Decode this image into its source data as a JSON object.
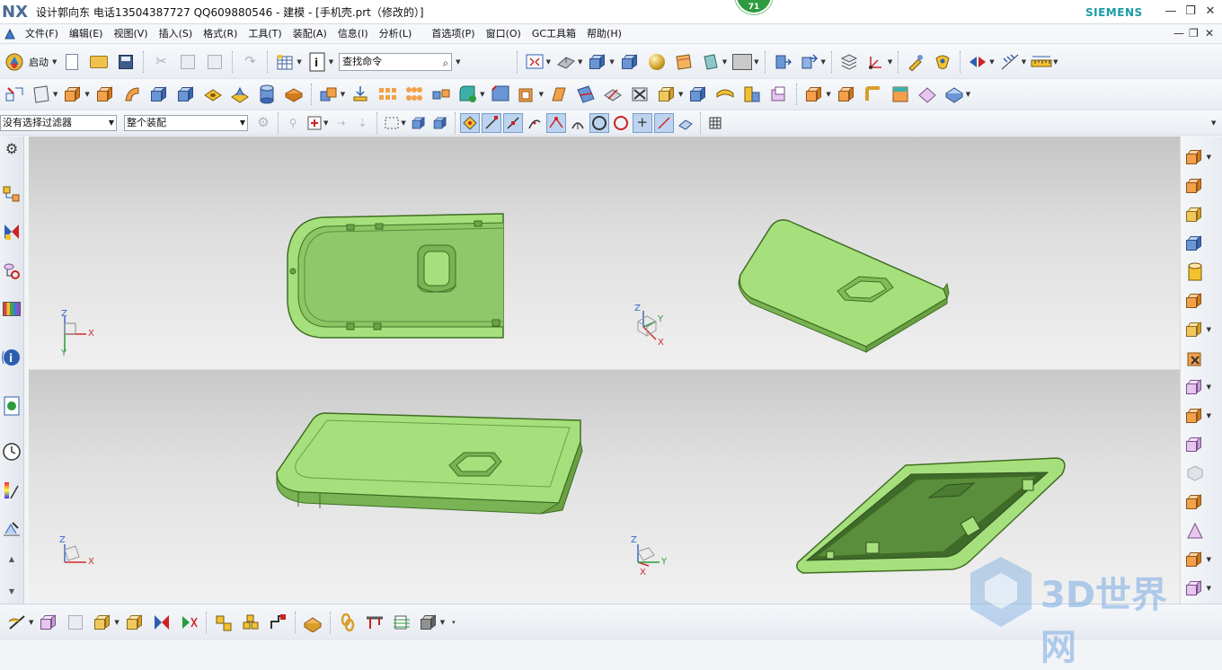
{
  "app": {
    "logo": "NX",
    "title": "设计郭向东  电话13504387727  QQ609880546 - 建模 - [手机壳.prt（修改的）]",
    "brand": "SIEMENS",
    "badge": "71",
    "window_controls": [
      "minimize-icon",
      "restore-icon",
      "close-icon"
    ]
  },
  "menu": {
    "items": [
      {
        "label": "文件(F)"
      },
      {
        "label": "编辑(E)"
      },
      {
        "label": "视图(V)"
      },
      {
        "label": "插入(S)"
      },
      {
        "label": "格式(R)"
      },
      {
        "label": "工具(T)"
      },
      {
        "label": "装配(A)"
      },
      {
        "label": "信息(I)"
      },
      {
        "label": "分析(L)"
      },
      {
        "label": "首选项(P)"
      },
      {
        "label": "窗口(O)"
      },
      {
        "label": "GC工具箱"
      },
      {
        "label": "帮助(H)"
      }
    ]
  },
  "toolbar1": {
    "start_label": "启动",
    "search_placeholder": "查找命令"
  },
  "toolbar3": {
    "selection_filter": "没有选择过滤器",
    "selection_scope": "整个装配"
  },
  "views": {
    "top_left_triad": {
      "z": "Z",
      "x": "X",
      "y": "Y"
    },
    "top_right_triad": {
      "z": "Z",
      "y": "Y",
      "x": "X"
    },
    "bottom_left_triad": {
      "z": "Z",
      "x": "X"
    },
    "bottom_right_triad": {
      "z": "Z",
      "x": "X",
      "y": "Y"
    }
  },
  "watermark": {
    "text": "3D世界网"
  },
  "colors": {
    "part_green": "#a6e07c",
    "part_edge": "#3f6e22",
    "brand_teal": "#1a9ba8",
    "badge_green": "#2e9b3e"
  }
}
